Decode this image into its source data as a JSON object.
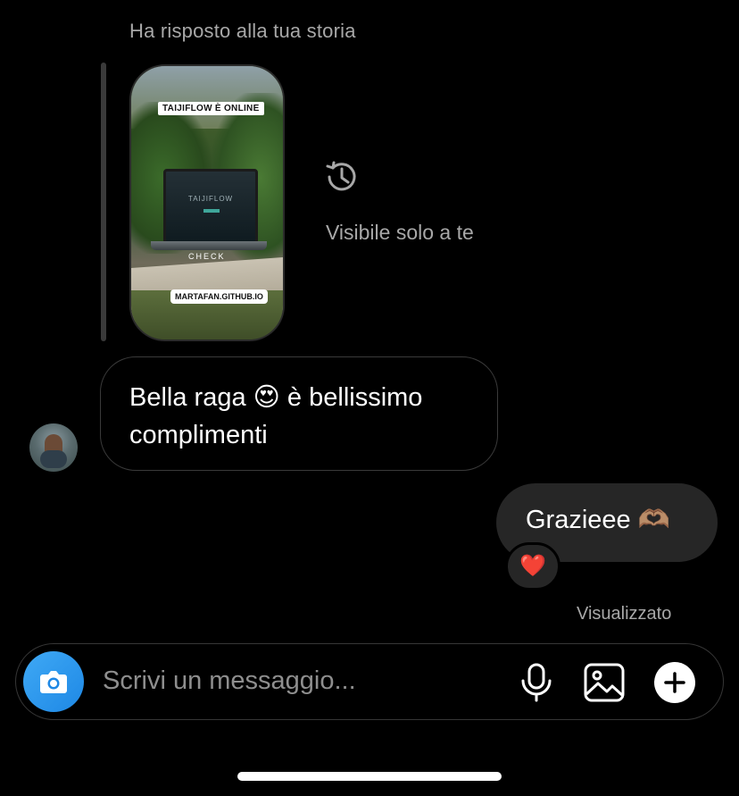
{
  "thread": {
    "reply_caption": "Ha risposto alla tua storia",
    "story": {
      "overlay_top": "TAIJIFLOW È ONLINE",
      "laptop_title": "TAIJIFLOW",
      "overlay_check": "CHECK",
      "overlay_link": "MARTAFAN.GITHUB.IO"
    },
    "visible_note": "Visibile solo a te",
    "incoming_message": "Bella raga 😍 è bellissimo complimenti",
    "outgoing_message": "Grazieee 🫶🏽",
    "reaction": "❤️",
    "seen_status": "Visualizzato"
  },
  "composer": {
    "placeholder": "Scrivi un messaggio...",
    "icons": [
      "camera-icon",
      "microphone-icon",
      "gallery-icon",
      "plus-icon"
    ]
  },
  "colors": {
    "background": "#000000",
    "outgoing_bubble": "#262626",
    "secondary_text": "#a8a8a8",
    "camera_button": "#1e88e5"
  }
}
